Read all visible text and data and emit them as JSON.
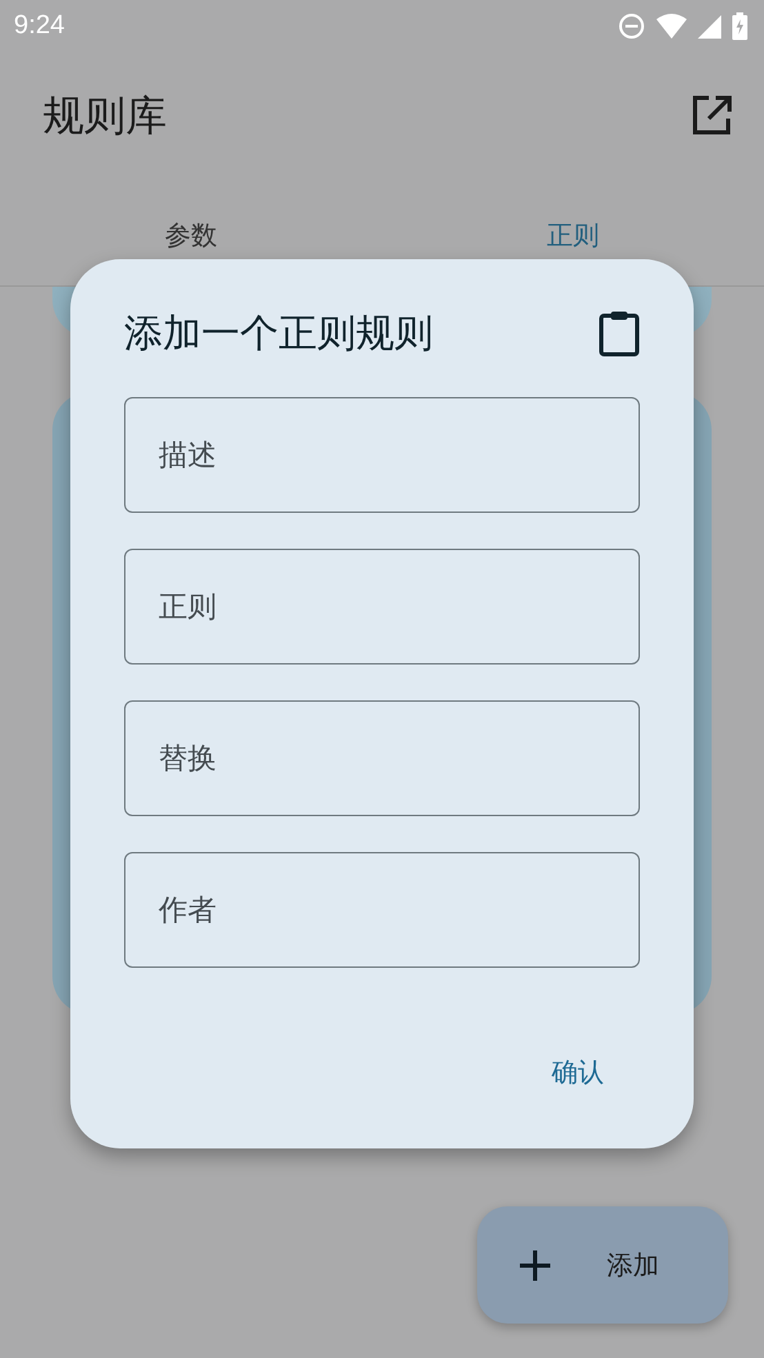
{
  "status_bar": {
    "time": "9:24"
  },
  "app_bar": {
    "title": "规则库"
  },
  "tabs": [
    {
      "label": "参数",
      "selected": false
    },
    {
      "label": "正则",
      "selected": true
    }
  ],
  "dialog": {
    "title": "添加一个正则规则",
    "fields": [
      {
        "placeholder": "描述"
      },
      {
        "placeholder": "正则"
      },
      {
        "placeholder": "替换"
      },
      {
        "placeholder": "作者"
      }
    ],
    "confirm": "确认"
  },
  "fab": {
    "label": "添加"
  }
}
